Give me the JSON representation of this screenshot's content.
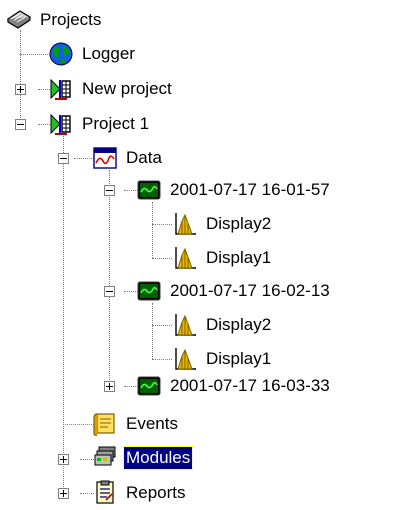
{
  "tree": {
    "root": {
      "label": "Projects",
      "icon": "projects-book-icon"
    },
    "logger": {
      "label": "Logger",
      "icon": "globe-icon"
    },
    "new_project": {
      "label": "New project",
      "icon": "project-icon",
      "expanded": false
    },
    "project1": {
      "label": "Project 1",
      "icon": "project-icon",
      "expanded": true,
      "data": {
        "label": "Data",
        "icon": "data-window-icon",
        "expanded": true,
        "runs": [
          {
            "label": "2001-07-17 16-01-57",
            "expanded": true,
            "displays": [
              "Display2",
              "Display1"
            ]
          },
          {
            "label": "2001-07-17 16-02-13",
            "expanded": true,
            "displays": [
              "Display2",
              "Display1"
            ]
          },
          {
            "label": "2001-07-17 16-03-33",
            "expanded": false,
            "displays": []
          }
        ]
      },
      "events": {
        "label": "Events",
        "icon": "events-icon"
      },
      "modules": {
        "label": "Modules",
        "icon": "modules-icon",
        "expanded": false,
        "selected": true
      },
      "reports": {
        "label": "Reports",
        "icon": "reports-icon",
        "expanded": false
      }
    }
  },
  "colors": {
    "selection": "#000080",
    "tree_lines": "#808080"
  }
}
